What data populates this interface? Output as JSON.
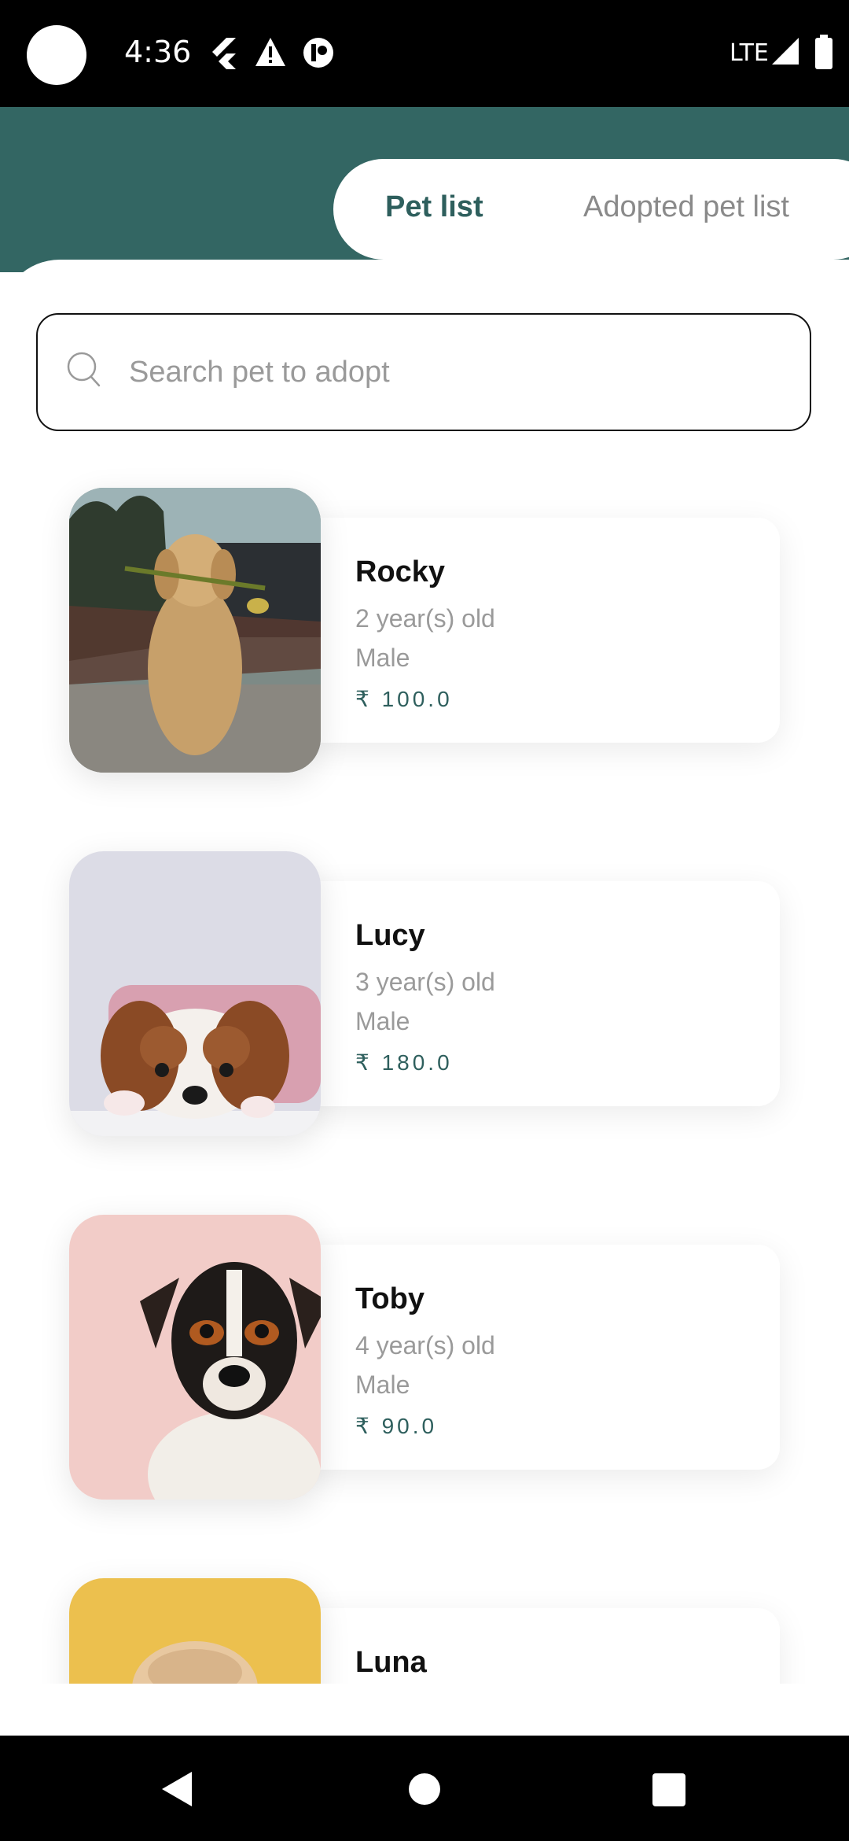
{
  "status_bar": {
    "time": "4:36",
    "network": "LTE",
    "icons": [
      "flutter-icon",
      "warning-icon",
      "app-icon",
      "signal-icon",
      "battery-icon"
    ]
  },
  "tabs": {
    "active": "Pet list",
    "inactive": "Adopted pet list"
  },
  "search": {
    "placeholder": "Search pet to adopt"
  },
  "pets": [
    {
      "name": "Rocky",
      "age": "2 year(s) old",
      "gender": "Male",
      "price": "₹ 100.0"
    },
    {
      "name": "Lucy",
      "age": "3 year(s) old",
      "gender": "Male",
      "price": "₹ 180.0"
    },
    {
      "name": "Toby",
      "age": "4 year(s) old",
      "gender": "Male",
      "price": "₹ 90.0"
    },
    {
      "name": "Luna"
    }
  ],
  "colors": {
    "header_teal": "#336663",
    "accent_text": "#2e5f5d",
    "muted_text": "#9a9a9a"
  }
}
